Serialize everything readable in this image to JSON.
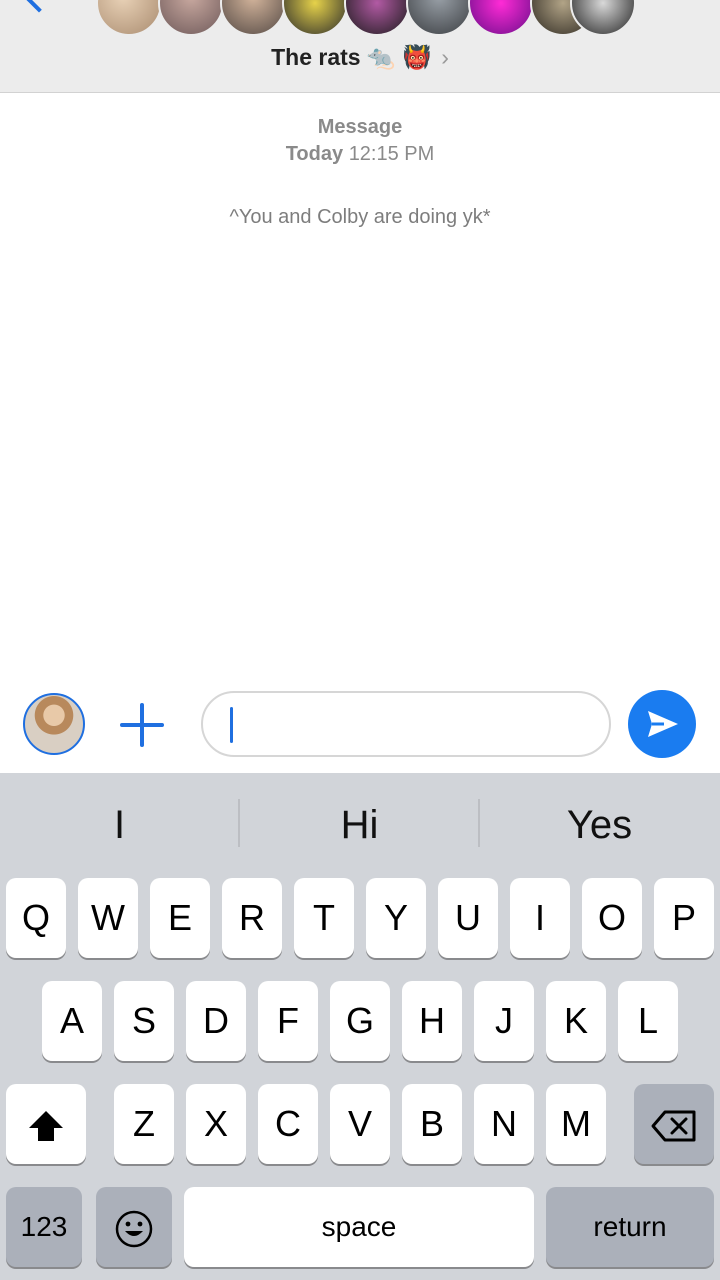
{
  "header": {
    "group_name": "The rats",
    "group_emoji": "🐀 👹",
    "participant_count_visible": 9
  },
  "thread": {
    "meta_label": "Message",
    "meta_day": "Today",
    "meta_time": "12:15 PM",
    "system_message": "^You and Colby are doing yk*"
  },
  "composer": {
    "input_value": ""
  },
  "keyboard": {
    "suggestions": [
      "I",
      "Hi",
      "Yes"
    ],
    "row1": [
      "Q",
      "W",
      "E",
      "R",
      "T",
      "Y",
      "U",
      "I",
      "O",
      "P"
    ],
    "row2": [
      "A",
      "S",
      "D",
      "F",
      "G",
      "H",
      "J",
      "K",
      "L"
    ],
    "row3": [
      "Z",
      "X",
      "C",
      "V",
      "B",
      "N",
      "M"
    ],
    "numbers_label": "123",
    "space_label": "space",
    "return_label": "return"
  },
  "colors": {
    "accent": "#1f6fe0",
    "send_button": "#1a7cf0",
    "keyboard_bg": "#d1d4d9",
    "header_bg": "#ececec"
  }
}
